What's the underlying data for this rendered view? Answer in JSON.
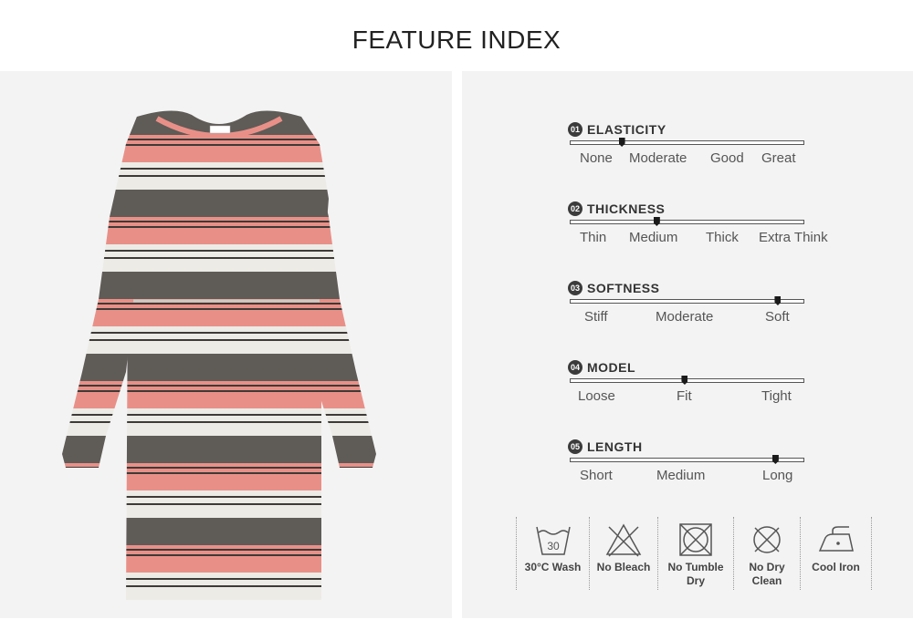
{
  "title": "FEATURE INDEX",
  "product": {
    "label_tag": ""
  },
  "features": [
    {
      "num": "01",
      "name": "ELASTICITY",
      "labels": [
        "None",
        "Moderate",
        "Good",
        "Great"
      ],
      "level": 0.22
    },
    {
      "num": "02",
      "name": "THICKNESS",
      "labels": [
        "Thin",
        "Medium",
        "Thick",
        "Extra Think"
      ],
      "level": 0.37
    },
    {
      "num": "03",
      "name": "SOFTNESS",
      "labels": [
        "Stiff",
        "Moderate",
        "Soft"
      ],
      "level": 0.89
    },
    {
      "num": "04",
      "name": "MODEL",
      "labels": [
        "Loose",
        "Fit",
        "Tight"
      ],
      "level": 0.49
    },
    {
      "num": "05",
      "name": "LENGTH",
      "labels": [
        "Short",
        "Medium",
        "Long"
      ],
      "level": 0.88
    }
  ],
  "care": [
    {
      "icon": "wash-30-icon",
      "line1": "30°C Wash",
      "line2": ""
    },
    {
      "icon": "no-bleach-icon",
      "line1": "No Bleach",
      "line2": ""
    },
    {
      "icon": "no-tumble-dry-icon",
      "line1": "No Tumble",
      "line2": "Dry"
    },
    {
      "icon": "no-dry-clean-icon",
      "line1": "No Dry",
      "line2": "Clean"
    },
    {
      "icon": "cool-iron-icon",
      "line1": "Cool Iron",
      "line2": ""
    }
  ],
  "wash_temp": "30",
  "colors": {
    "stripe_gray": "#5f5b57",
    "stripe_pink": "#e89088",
    "stripe_white": "#ecebe6",
    "line_dark": "#3d3a37"
  }
}
